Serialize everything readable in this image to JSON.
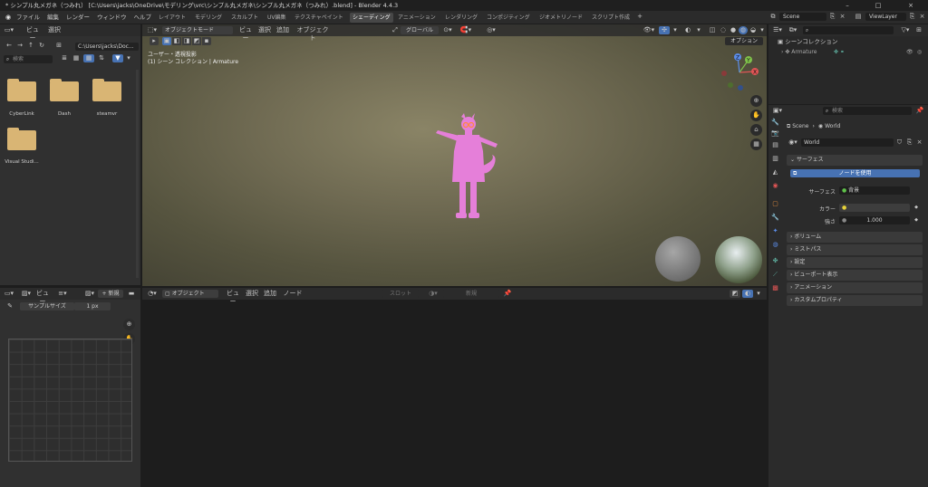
{
  "window": {
    "title": "* シンプル丸メガネ（つみれ） [C:\\Users\\jacks\\OneDrive\\モデリング\\vrc\\シンプル丸メガネ\\シンプル丸メガネ（つみれ）.blend] - Blender 4.4.3",
    "minimize": "–",
    "maximize": "□",
    "close": "×"
  },
  "menu": [
    "ファイル",
    "編集",
    "レンダー",
    "ウィンドウ",
    "ヘルプ"
  ],
  "workspaces": [
    {
      "label": "レイアウト"
    },
    {
      "label": "モデリング"
    },
    {
      "label": "スカルプト"
    },
    {
      "label": "UV編集"
    },
    {
      "label": "テクスチャペイント"
    },
    {
      "label": "シェーディング",
      "active": true
    },
    {
      "label": "アニメーション"
    },
    {
      "label": "レンダリング"
    },
    {
      "label": "コンポジティング"
    },
    {
      "label": "ジオメトリノード"
    },
    {
      "label": "スクリプト作成"
    }
  ],
  "add_tab": "+",
  "scene": "Scene",
  "view_layer": "ViewLayer",
  "filebrowser": {
    "view": "ビュー",
    "select": "選択",
    "path": "C:\\Users\\jacks\\Doc...",
    "search_placeholder": "検索",
    "items": [
      "CyberLink",
      "Dash",
      "steamvr",
      "Visual Studi..."
    ]
  },
  "viewport": {
    "mode": "オブジェクトモード",
    "view": "ビュー",
    "select": "選択",
    "add": "追加",
    "object": "オブジェクト",
    "orientation": "グローバル",
    "options": "オプション",
    "info_line1": "ユーザー・透視投影",
    "info_line2": "(1) シーン コレクション | Armature",
    "gizmo_x": "X",
    "gizmo_y": "Y",
    "gizmo_z": "Z"
  },
  "image_editor": {
    "view": "ビュー",
    "new": "新規",
    "sample_label": "サンプルサイズ",
    "sample_value": "1 px"
  },
  "node_editor": {
    "mode": "オブジェクト",
    "view": "ビュー",
    "select": "選択",
    "add": "追加",
    "node": "ノード",
    "slot": "スロット",
    "new": "新規"
  },
  "outliner": {
    "search_placeholder": "",
    "collection": "シーンコレクション",
    "armature": "Armature"
  },
  "properties": {
    "search_placeholder": "検索",
    "breadcrumb_scene": "Scene",
    "breadcrumb_world": "World",
    "world_name": "World",
    "surface_section": "サーフェス",
    "use_nodes": "ノードを使用",
    "surface_label": "サーフェス",
    "surface_value": "背景",
    "color_label": "カラー",
    "strength_label": "強さ",
    "strength_value": "1.000",
    "sections": [
      "ボリューム",
      "ミストパス",
      "設定",
      "ビューポート表示",
      "アニメーション",
      "カスタムプロパティ"
    ]
  },
  "colors": {
    "accent": "#4772b3",
    "active_tab": "#474747",
    "character": "#e57fd9"
  }
}
